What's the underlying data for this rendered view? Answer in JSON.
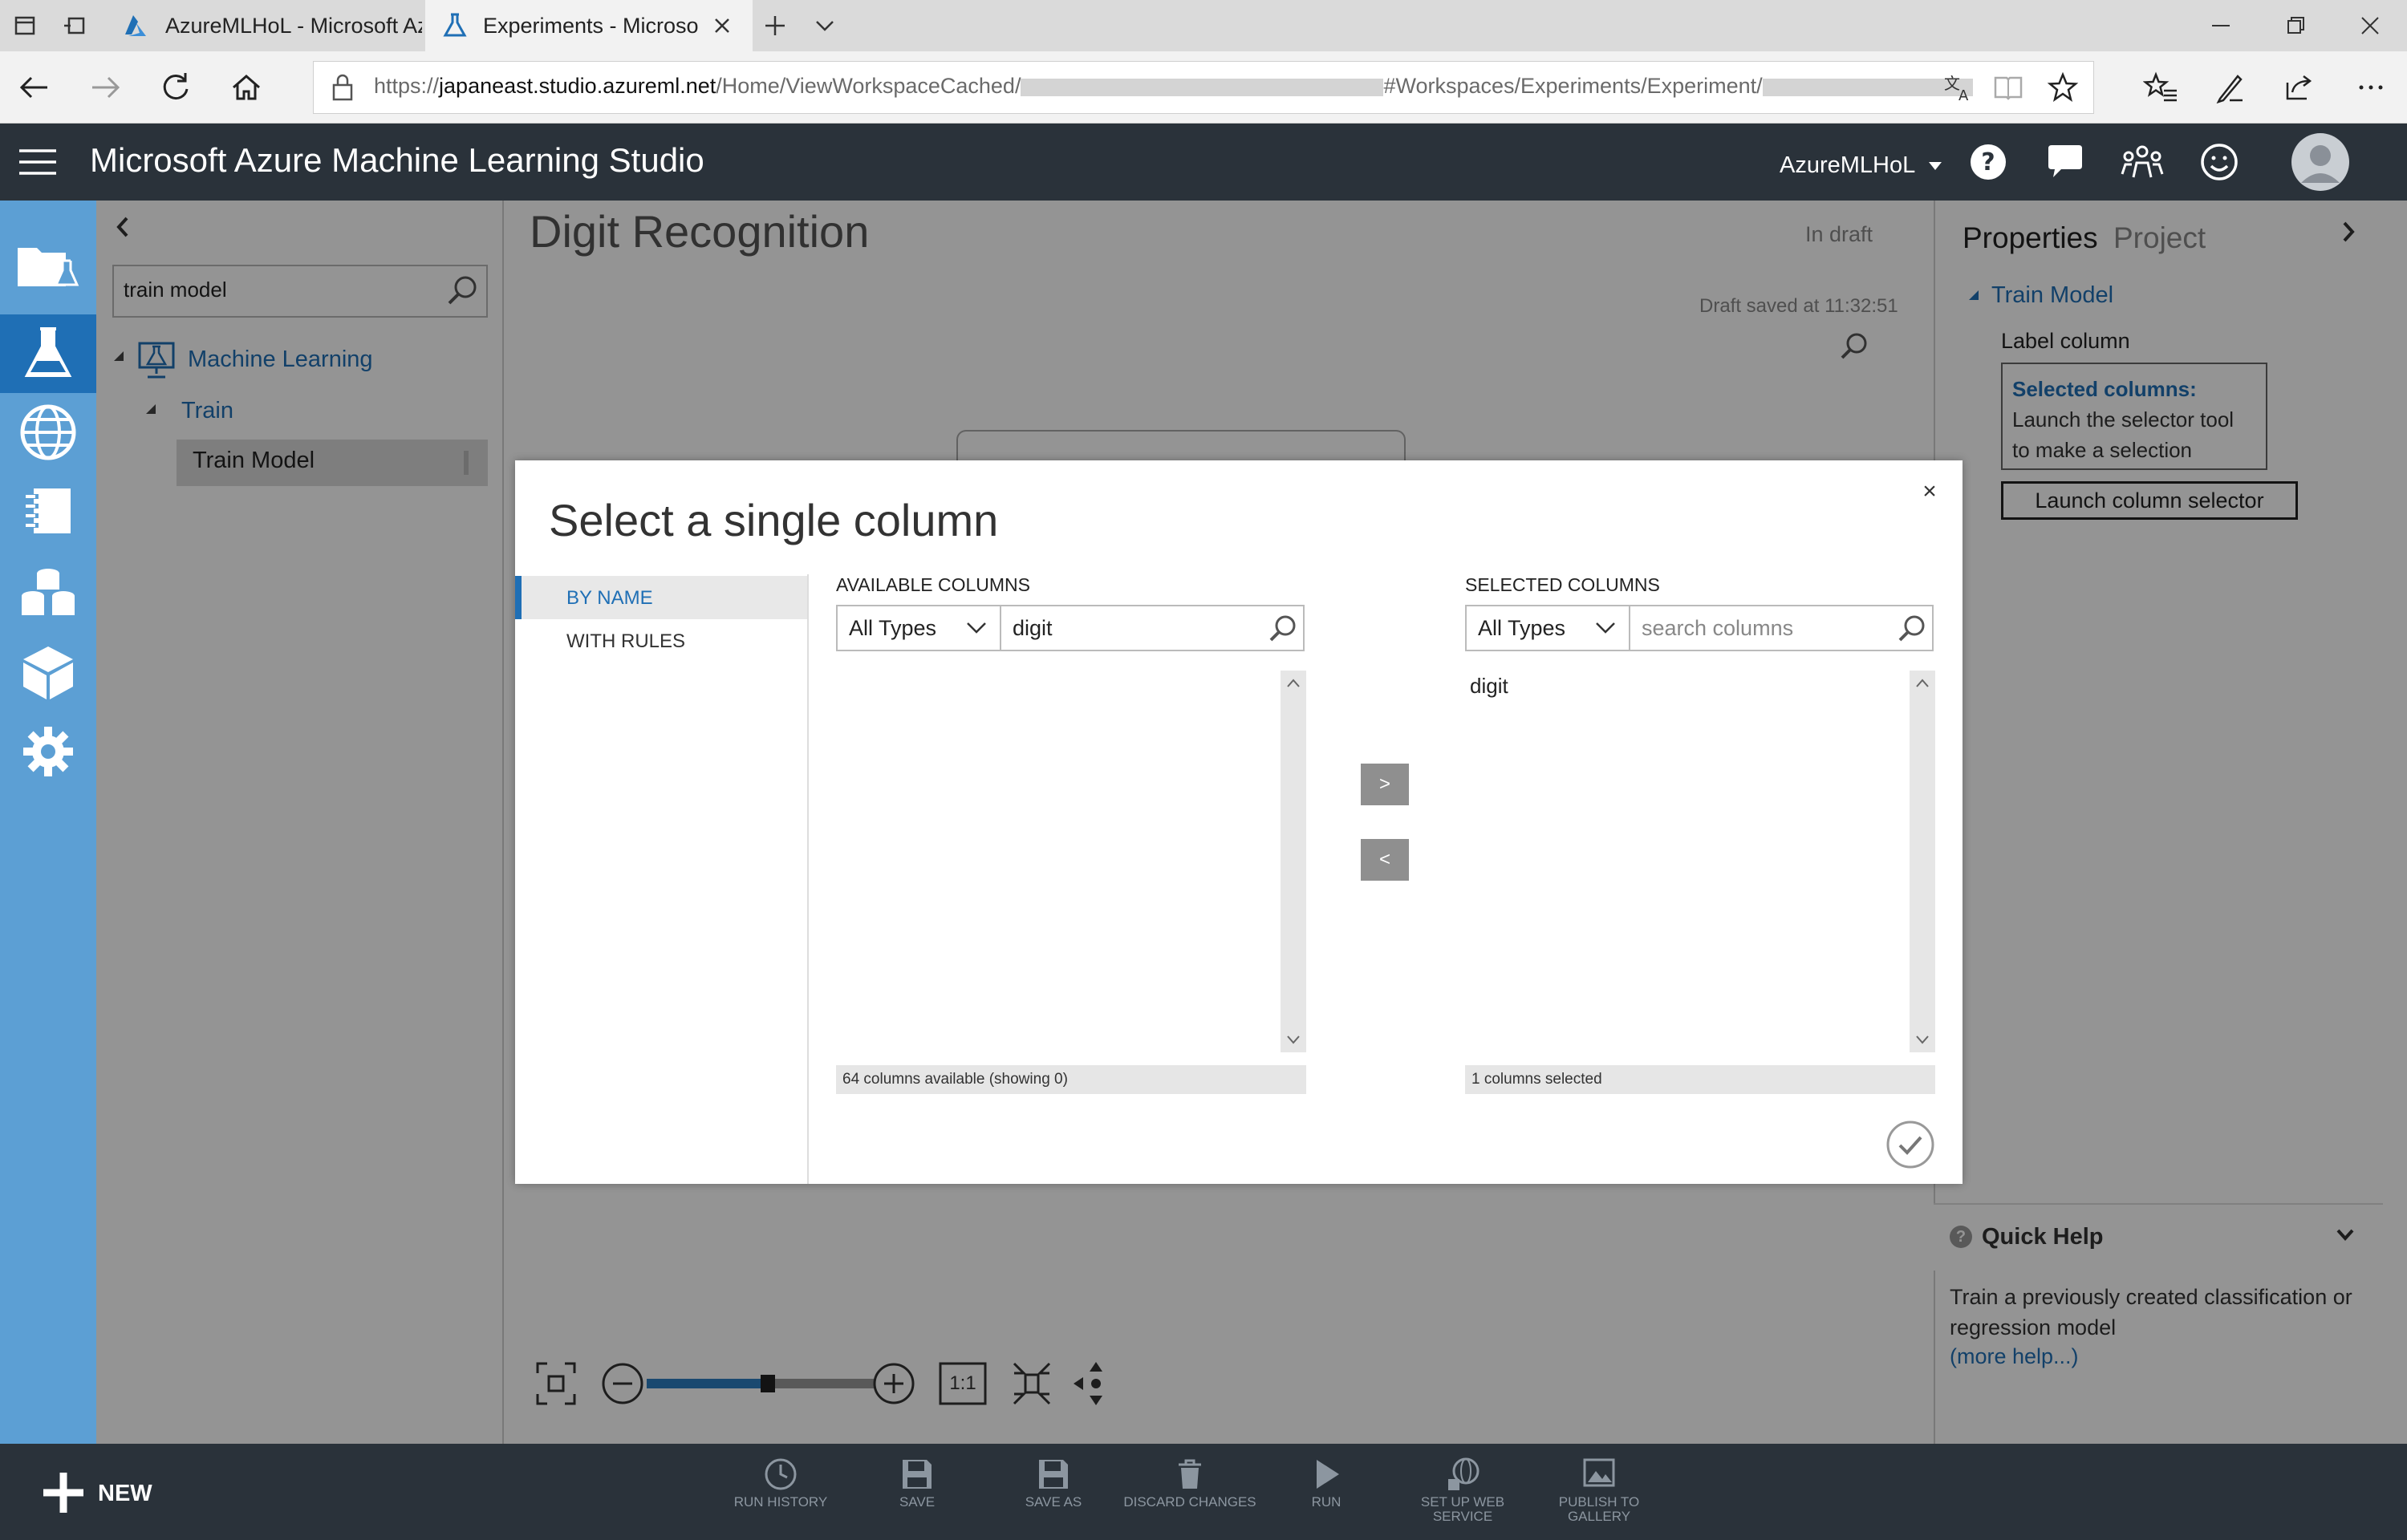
{
  "browser": {
    "tabs": [
      {
        "title": "AzureMLHoL - Microsoft Az",
        "active": false
      },
      {
        "title": "Experiments - Microsoft",
        "active": true
      }
    ],
    "url": {
      "prefix": "https://",
      "host": "japaneast.studio.azureml.net",
      "path1": "/Home/ViewWorkspaceCached/",
      "path2": "#Workspaces/Experiments/Experiment/"
    }
  },
  "app": {
    "title": "Microsoft Azure Machine Learning Studio",
    "workspace": "AzureMLHoL"
  },
  "palette": {
    "search_value": "train model",
    "tree": {
      "category": "Machine Learning",
      "subcategory": "Train",
      "module": "Train Model"
    }
  },
  "canvas": {
    "experiment_title": "Digit Recognition",
    "status": "In draft",
    "draft_saved": "Draft saved at 11:32:51",
    "zoom_reset_label": "1:1"
  },
  "properties": {
    "tab_properties": "Properties",
    "tab_project": "Project",
    "module_name": "Train Model",
    "label_column": "Label column",
    "selected_heading": "Selected columns:",
    "selected_hint": "Launch the selector tool to make a selection",
    "launch_button": "Launch column selector",
    "quick_help_title": "Quick Help",
    "quick_help_text": "Train a previously created classification or regression model",
    "more_help": "(more help...)"
  },
  "modal": {
    "title": "Select a single column",
    "tabs": [
      "BY NAME",
      "WITH RULES"
    ],
    "available": {
      "header": "AVAILABLE COLUMNS",
      "type_filter": "All Types",
      "search_value": "digit",
      "status": "64 columns available (showing 0)"
    },
    "selected": {
      "header": "SELECTED COLUMNS",
      "type_filter": "All Types",
      "search_placeholder": "search columns",
      "items": [
        "digit"
      ],
      "status": "1 columns selected"
    },
    "move_right": ">",
    "move_left": "<"
  },
  "commandbar": {
    "new_label": "NEW",
    "commands": [
      {
        "label": "RUN HISTORY",
        "icon": "clock-icon"
      },
      {
        "label": "SAVE",
        "icon": "save-icon"
      },
      {
        "label": "SAVE AS",
        "icon": "save-as-icon"
      },
      {
        "label": "DISCARD CHANGES",
        "icon": "trash-icon"
      },
      {
        "label": "RUN",
        "icon": "play-icon"
      },
      {
        "label": "SET UP WEB SERVICE",
        "icon": "web-service-icon"
      },
      {
        "label": "PUBLISH TO GALLERY",
        "icon": "gallery-icon"
      }
    ]
  },
  "colors": {
    "header_bg": "#2a323a",
    "rail_bg": "#5c9fd4",
    "accent": "#1f6fb5"
  }
}
